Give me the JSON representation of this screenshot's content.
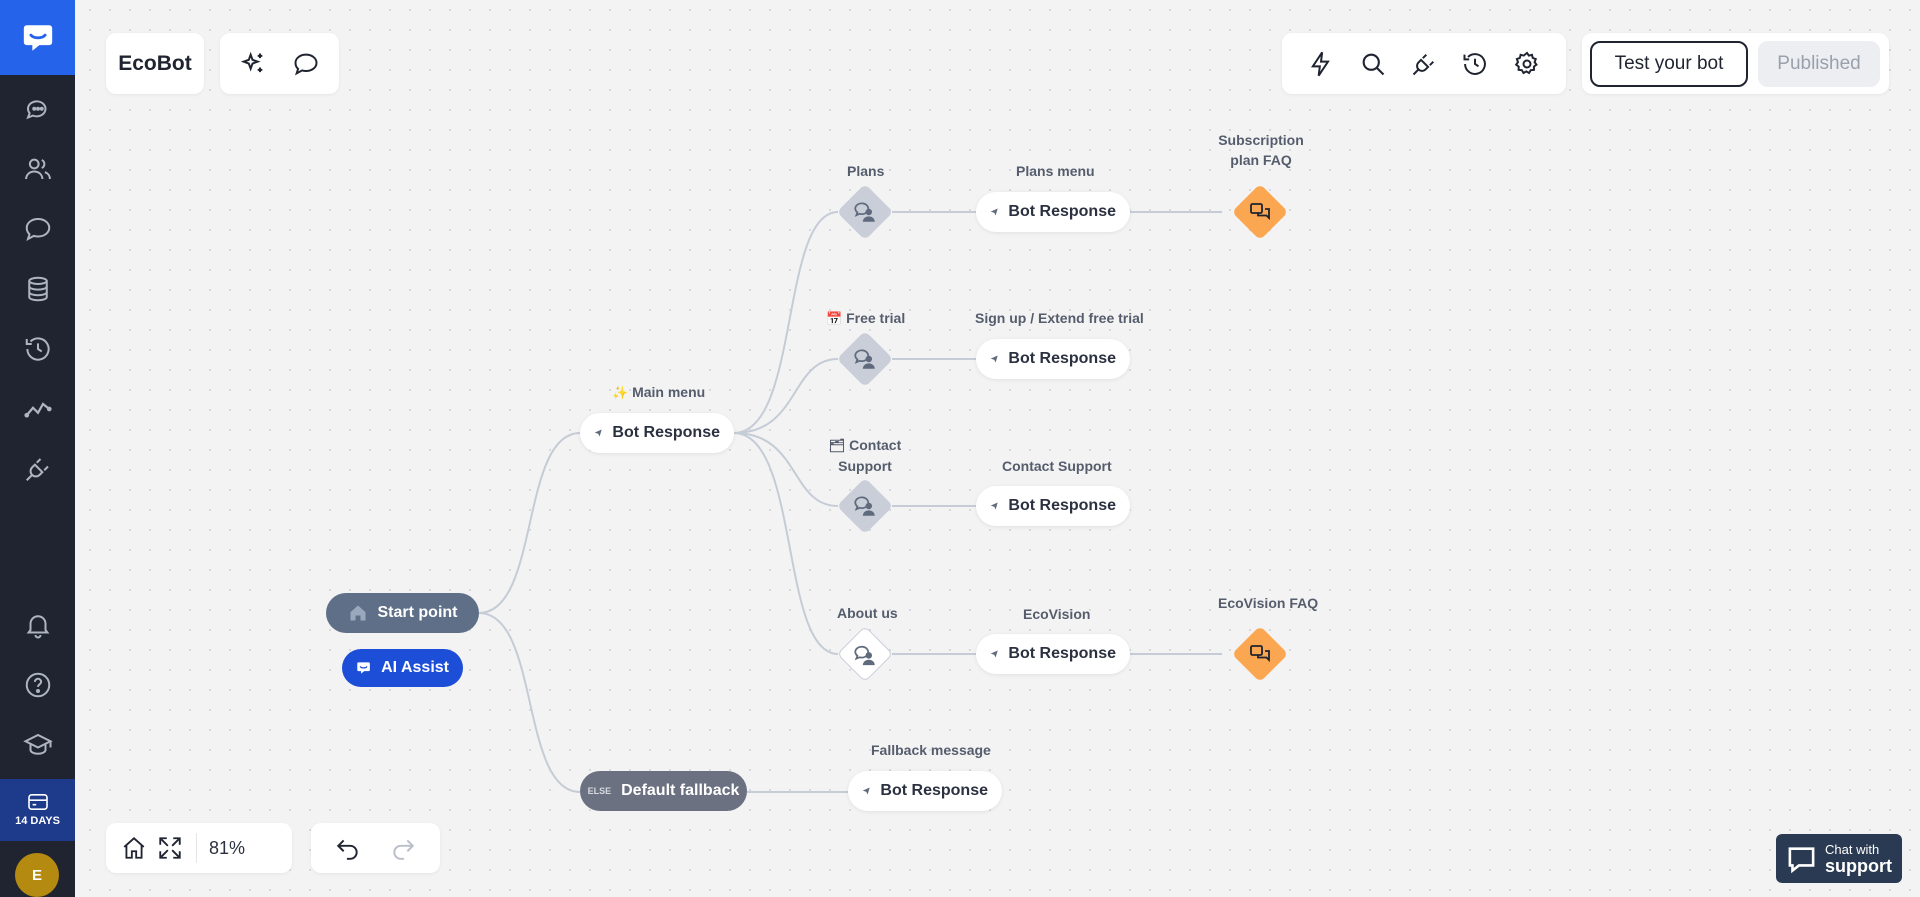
{
  "app": {
    "bot_name": "EcoBot",
    "trial_label": "14 DAYS",
    "user_initial": "E",
    "accent": "#2563eb"
  },
  "sidebar": {
    "items": [
      {
        "icon": "chat-bubbles-icon"
      },
      {
        "icon": "users-icon"
      },
      {
        "icon": "conversation-icon"
      },
      {
        "icon": "database-icon"
      },
      {
        "icon": "history-icon"
      },
      {
        "icon": "analytics-icon"
      },
      {
        "icon": "integrations-plug-icon"
      }
    ],
    "bottom": [
      {
        "icon": "bell-icon"
      },
      {
        "icon": "help-icon"
      },
      {
        "icon": "academy-icon"
      }
    ]
  },
  "toolbar": {
    "test_label": "Test your bot",
    "published_label": "Published"
  },
  "flow": {
    "start_label": "Start point",
    "ai_assist_label": "AI Assist",
    "main_menu_label": "Main menu",
    "bot_response_label": "Bot Response",
    "default_fallback_label": "Default fallback",
    "else_tag": "ELSE",
    "fallback_message_label": "Fallback message",
    "branches": [
      {
        "intent": "Plans",
        "response_title": "Plans menu",
        "goto": "Subscription plan FAQ"
      },
      {
        "intent": "Free trial",
        "response_title": "Sign up / Extend free trial"
      },
      {
        "intent": "Contact Support",
        "response_title": "Contact Support"
      },
      {
        "intent": "About us",
        "response_title": "EcoVision",
        "goto": "EcoVision FAQ"
      }
    ]
  },
  "bottom_bar": {
    "zoom": "81%"
  },
  "support": {
    "line1": "Chat with",
    "line2": "support"
  },
  "colors": {
    "sidebar_bg": "#1f2430",
    "start_pill": "#5f6f88",
    "ai_pill": "#1d4ed8",
    "fallback_pill": "#6b7181",
    "goto_node": "#fba651",
    "edge": "#c5ccd6"
  }
}
